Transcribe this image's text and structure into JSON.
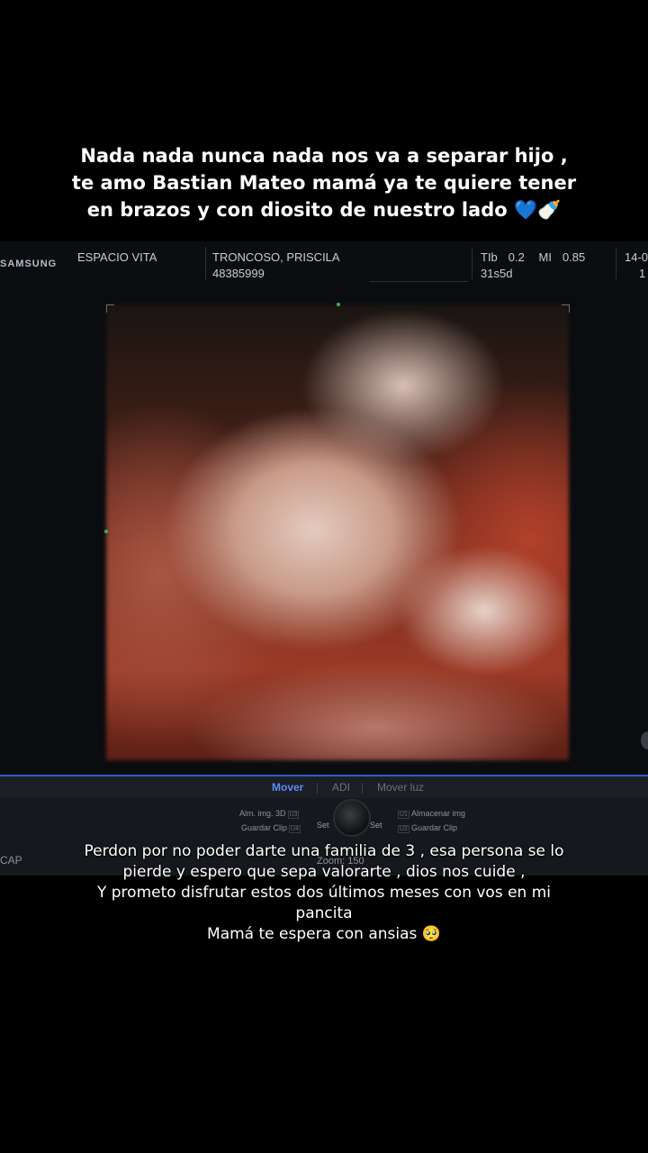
{
  "caption_top": {
    "line1": "Nada nada nunca nada nos va a separar hijo ,",
    "line2": "te amo Bastian Mateo mamá ya te quiere tener",
    "line3": "en brazos y con diosito de nuestro lado 💙🍼"
  },
  "ultrasound_header": {
    "brand": "SAMSUNG",
    "clinic": "ESPACIO VITA",
    "patient_name": "TRONCOSO, PRISCILA",
    "patient_id": "48385999",
    "tib_label": "TIb",
    "tib_value": "0.2",
    "mi_label": "MI",
    "mi_value": "0.85",
    "gestation": "31s5d",
    "extra_top": "14-0",
    "extra_bottom": "1"
  },
  "tabs": {
    "mover": "Mover",
    "adi": "ADI",
    "mover_luz": "Mover luz"
  },
  "controls": {
    "alm_img_3d": "Alm. img. 3D",
    "alm_img_3d_key": "U3",
    "guardar_clip_left": "Guardar Clip",
    "guardar_clip_left_key": "U4",
    "set_left": "Set",
    "set_right": "Set",
    "almacenar_img": "Almacenar img",
    "almacenar_img_key": "U1",
    "guardar_clip_right": "Guardar Clip",
    "guardar_clip_right_key": "U2",
    "cap": "CAP",
    "zoom": "Zoom: 150"
  },
  "caption_bottom": {
    "line1": "Perdon por no poder darte una familia de 3 , esa persona se lo",
    "line2": "pierde  y espero que sepa valorarte , dios nos cuide ,",
    "line3": "Y prometo disfrutar estos dos últimos meses con vos en mi",
    "line4": "pancita",
    "line5": "Mamá te espera con ansias 🥺"
  }
}
